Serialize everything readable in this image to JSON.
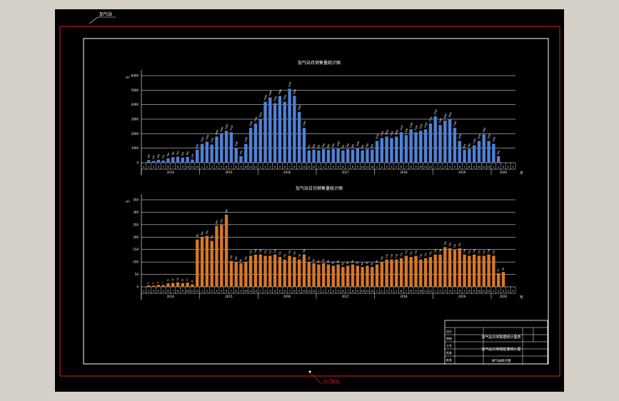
{
  "sheet": {
    "top_tag": "加气站",
    "bottom_tag": "4×Tenk"
  },
  "title_block": {
    "main_title": "加气站日常数据统计图表",
    "sub_title": "加气站日常销售量统计图",
    "drawing_no": "加气站统计图",
    "labels": [
      "设计",
      "审核",
      "工艺",
      "标准",
      "批准",
      "日期"
    ]
  },
  "charts": {
    "top_title": "加气站月销售量统计图",
    "bottom_title": "加气站日均销售量统计图"
  },
  "chart_data": [
    {
      "type": "bar",
      "title": "加气站月销售量统计图",
      "ylabel": "m³",
      "xlabel": "月",
      "ylim": [
        0,
        6000
      ],
      "yticks": [
        "0",
        "1000",
        "2000",
        "3000",
        "4000",
        "5000",
        "6000"
      ],
      "grid": true,
      "bar_color": "#4f82d6",
      "years": [
        {
          "label": "2014",
          "start": 0,
          "count": 12
        },
        {
          "label": "2015",
          "start": 12,
          "count": 12
        },
        {
          "label": "2016",
          "start": 24,
          "count": 12
        },
        {
          "label": "2017",
          "start": 36,
          "count": 12
        },
        {
          "label": "2018",
          "start": 48,
          "count": 12
        },
        {
          "label": "2019",
          "start": 60,
          "count": 12
        },
        {
          "label": "2020",
          "start": 72,
          "count": 5
        }
      ],
      "months": [
        "1",
        "2",
        "3",
        "4",
        "5",
        "6",
        "7",
        "8",
        "9",
        "10",
        "11",
        "12",
        "1",
        "2",
        "3",
        "4",
        "5",
        "6",
        "7",
        "8",
        "9",
        "10",
        "11",
        "12",
        "1",
        "2",
        "3",
        "4",
        "5",
        "6",
        "7",
        "8",
        "9",
        "10",
        "11",
        "12",
        "1",
        "2",
        "3",
        "4",
        "5",
        "6",
        "7",
        "8",
        "9",
        "10",
        "11",
        "12",
        "1",
        "2",
        "3",
        "4",
        "5",
        "6",
        "7",
        "8",
        "9",
        "10",
        "11",
        "12",
        "1",
        "2",
        "3",
        "4",
        "5",
        "6",
        "7",
        "8",
        "9",
        "10",
        "11",
        "12",
        "1",
        "2",
        "3",
        "4",
        "5"
      ],
      "values": [
        0,
        180,
        120,
        200,
        150,
        300,
        380,
        420,
        350,
        400,
        220,
        900,
        1300,
        1450,
        1250,
        1800,
        2000,
        2200,
        2100,
        1000,
        450,
        1300,
        2400,
        2700,
        3000,
        4200,
        4500,
        4100,
        4600,
        4200,
        5100,
        4600,
        3500,
        2400,
        850,
        900,
        850,
        950,
        900,
        950,
        1000,
        850,
        950,
        900,
        1000,
        850,
        950,
        900,
        1500,
        1700,
        1800,
        1700,
        1800,
        2100,
        1900,
        2300,
        2100,
        2200,
        2300,
        2700,
        3200,
        2600,
        2900,
        3000,
        2400,
        1500,
        900,
        950,
        1200,
        1500,
        1950,
        1500,
        1300,
        450,
        0,
        0,
        0
      ]
    },
    {
      "type": "bar",
      "title": "加气站日均销售量统计图",
      "ylabel": "m³",
      "xlabel": "月",
      "ylim": [
        0,
        350
      ],
      "yticks": [
        "0",
        "50",
        "100",
        "150",
        "200",
        "250",
        "300",
        "350"
      ],
      "grid": true,
      "bar_color": "#d67828",
      "years": [
        {
          "label": "2014",
          "start": 0,
          "count": 12
        },
        {
          "label": "2015",
          "start": 12,
          "count": 12
        },
        {
          "label": "2016",
          "start": 24,
          "count": 12
        },
        {
          "label": "2017",
          "start": 36,
          "count": 12
        },
        {
          "label": "2018",
          "start": 48,
          "count": 12
        },
        {
          "label": "2019",
          "start": 60,
          "count": 12
        },
        {
          "label": "2020",
          "start": 72,
          "count": 5
        }
      ],
      "months": [
        "1",
        "2",
        "3",
        "4",
        "5",
        "6",
        "7",
        "8",
        "9",
        "10",
        "11",
        "12",
        "1",
        "2",
        "3",
        "4",
        "5",
        "6",
        "7",
        "8",
        "9",
        "10",
        "11",
        "12",
        "1",
        "2",
        "3",
        "4",
        "5",
        "6",
        "7",
        "8",
        "9",
        "10",
        "11",
        "12",
        "1",
        "2",
        "3",
        "4",
        "5",
        "6",
        "7",
        "8",
        "9",
        "10",
        "11",
        "12",
        "1",
        "2",
        "3",
        "4",
        "5",
        "6",
        "7",
        "8",
        "9",
        "10",
        "11",
        "12",
        "1",
        "2",
        "3",
        "4",
        "5",
        "6",
        "7",
        "8",
        "9",
        "10",
        "11",
        "12",
        "1",
        "2",
        "3",
        "4",
        "5"
      ],
      "values": [
        0,
        6,
        5,
        8,
        7,
        14,
        16,
        18,
        15,
        17,
        10,
        190,
        200,
        205,
        185,
        245,
        250,
        290,
        105,
        100,
        95,
        100,
        125,
        130,
        130,
        125,
        125,
        130,
        120,
        110,
        125,
        120,
        110,
        130,
        100,
        95,
        90,
        95,
        90,
        85,
        90,
        80,
        85,
        90,
        85,
        80,
        85,
        80,
        90,
        100,
        110,
        110,
        110,
        115,
        125,
        120,
        125,
        110,
        115,
        120,
        130,
        130,
        160,
        155,
        150,
        155,
        130,
        125,
        130,
        125,
        125,
        130,
        125,
        55,
        60,
        0,
        0
      ]
    }
  ]
}
